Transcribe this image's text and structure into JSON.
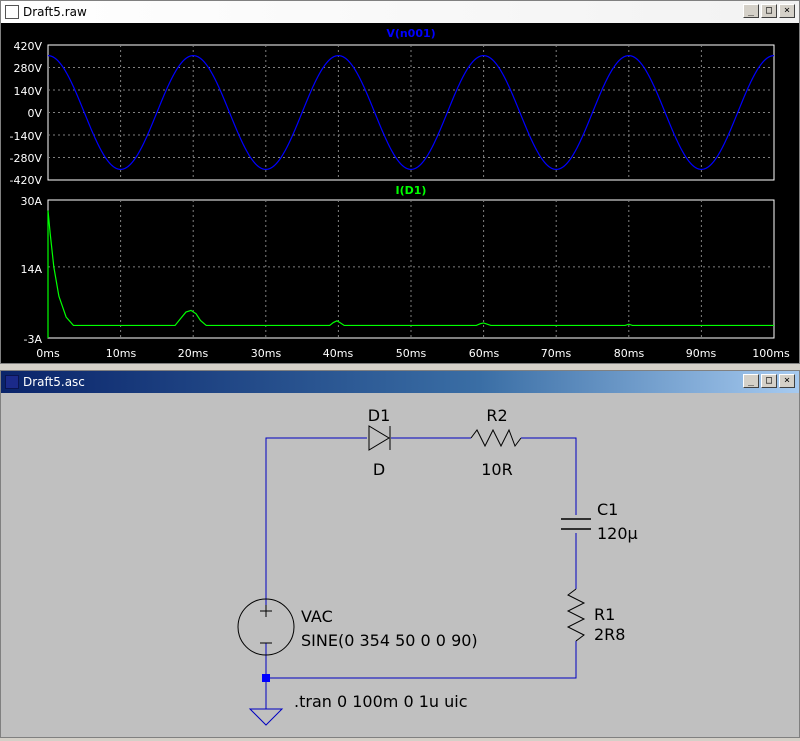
{
  "waveform_window": {
    "title": "Draft5.raw",
    "buttons": {
      "minimize": "_",
      "maximize": "□",
      "close": "×"
    }
  },
  "schematic_window": {
    "title": "Draft5.asc",
    "buttons": {
      "minimize": "_",
      "maximize": "□",
      "close": "×"
    }
  },
  "colors": {
    "voltage_trace": "#0000ff",
    "current_trace": "#00ff00",
    "grid": "#808080",
    "wire": "#0000c0"
  },
  "chart_data": [
    {
      "type": "line",
      "title": "V(n001)",
      "series": [
        {
          "name": "V(n001)",
          "color": "#0000ff",
          "function": "sine",
          "amplitude": 354,
          "frequency_hz": 50,
          "phase_deg": 90
        }
      ],
      "x_range_ms": [
        0,
        100
      ],
      "ylim": [
        -420,
        420
      ],
      "y_ticks": [
        "420V",
        "280V",
        "140V",
        "0V",
        "-140V",
        "-280V",
        "-420V"
      ],
      "grid": true
    },
    {
      "type": "line",
      "title": "I(D1)",
      "series": [
        {
          "name": "I(D1)",
          "color": "#00ff00",
          "x": [
            0,
            0.3,
            0.8,
            1.5,
            2.5,
            3.5,
            17.5,
            18.2,
            19.0,
            19.7,
            20.4,
            21.0,
            21.8,
            38.8,
            39.3,
            39.8,
            40.3,
            40.8,
            59.0,
            59.5,
            60.0,
            60.5,
            61.0,
            79.5,
            80.0,
            80.5,
            100
          ],
          "y": [
            27.5,
            22,
            14,
            7,
            2,
            0,
            0,
            1.5,
            3.2,
            3.6,
            2.8,
            1.2,
            0,
            0,
            0.7,
            1.1,
            0.6,
            0,
            0,
            0.4,
            0.6,
            0.3,
            0,
            0,
            0.3,
            0,
            0
          ]
        }
      ],
      "ylim": [
        -3,
        30
      ],
      "y_ticks": [
        "30A",
        "14A",
        "-3A"
      ],
      "x_ticks": [
        "0ms",
        "10ms",
        "20ms",
        "30ms",
        "40ms",
        "50ms",
        "60ms",
        "70ms",
        "80ms",
        "90ms",
        "100ms"
      ],
      "grid": true
    }
  ],
  "schematic": {
    "d1": {
      "name": "D1",
      "value": "D"
    },
    "r2": {
      "name": "R2",
      "value": "10R"
    },
    "c1": {
      "name": "C1",
      "value": "120µ"
    },
    "r1": {
      "name": "R1",
      "value": "2R8"
    },
    "vac": {
      "name": "VAC",
      "value": "SINE(0 354 50 0 0 90)"
    },
    "directive": ".tran 0 100m 0 1u uic"
  }
}
